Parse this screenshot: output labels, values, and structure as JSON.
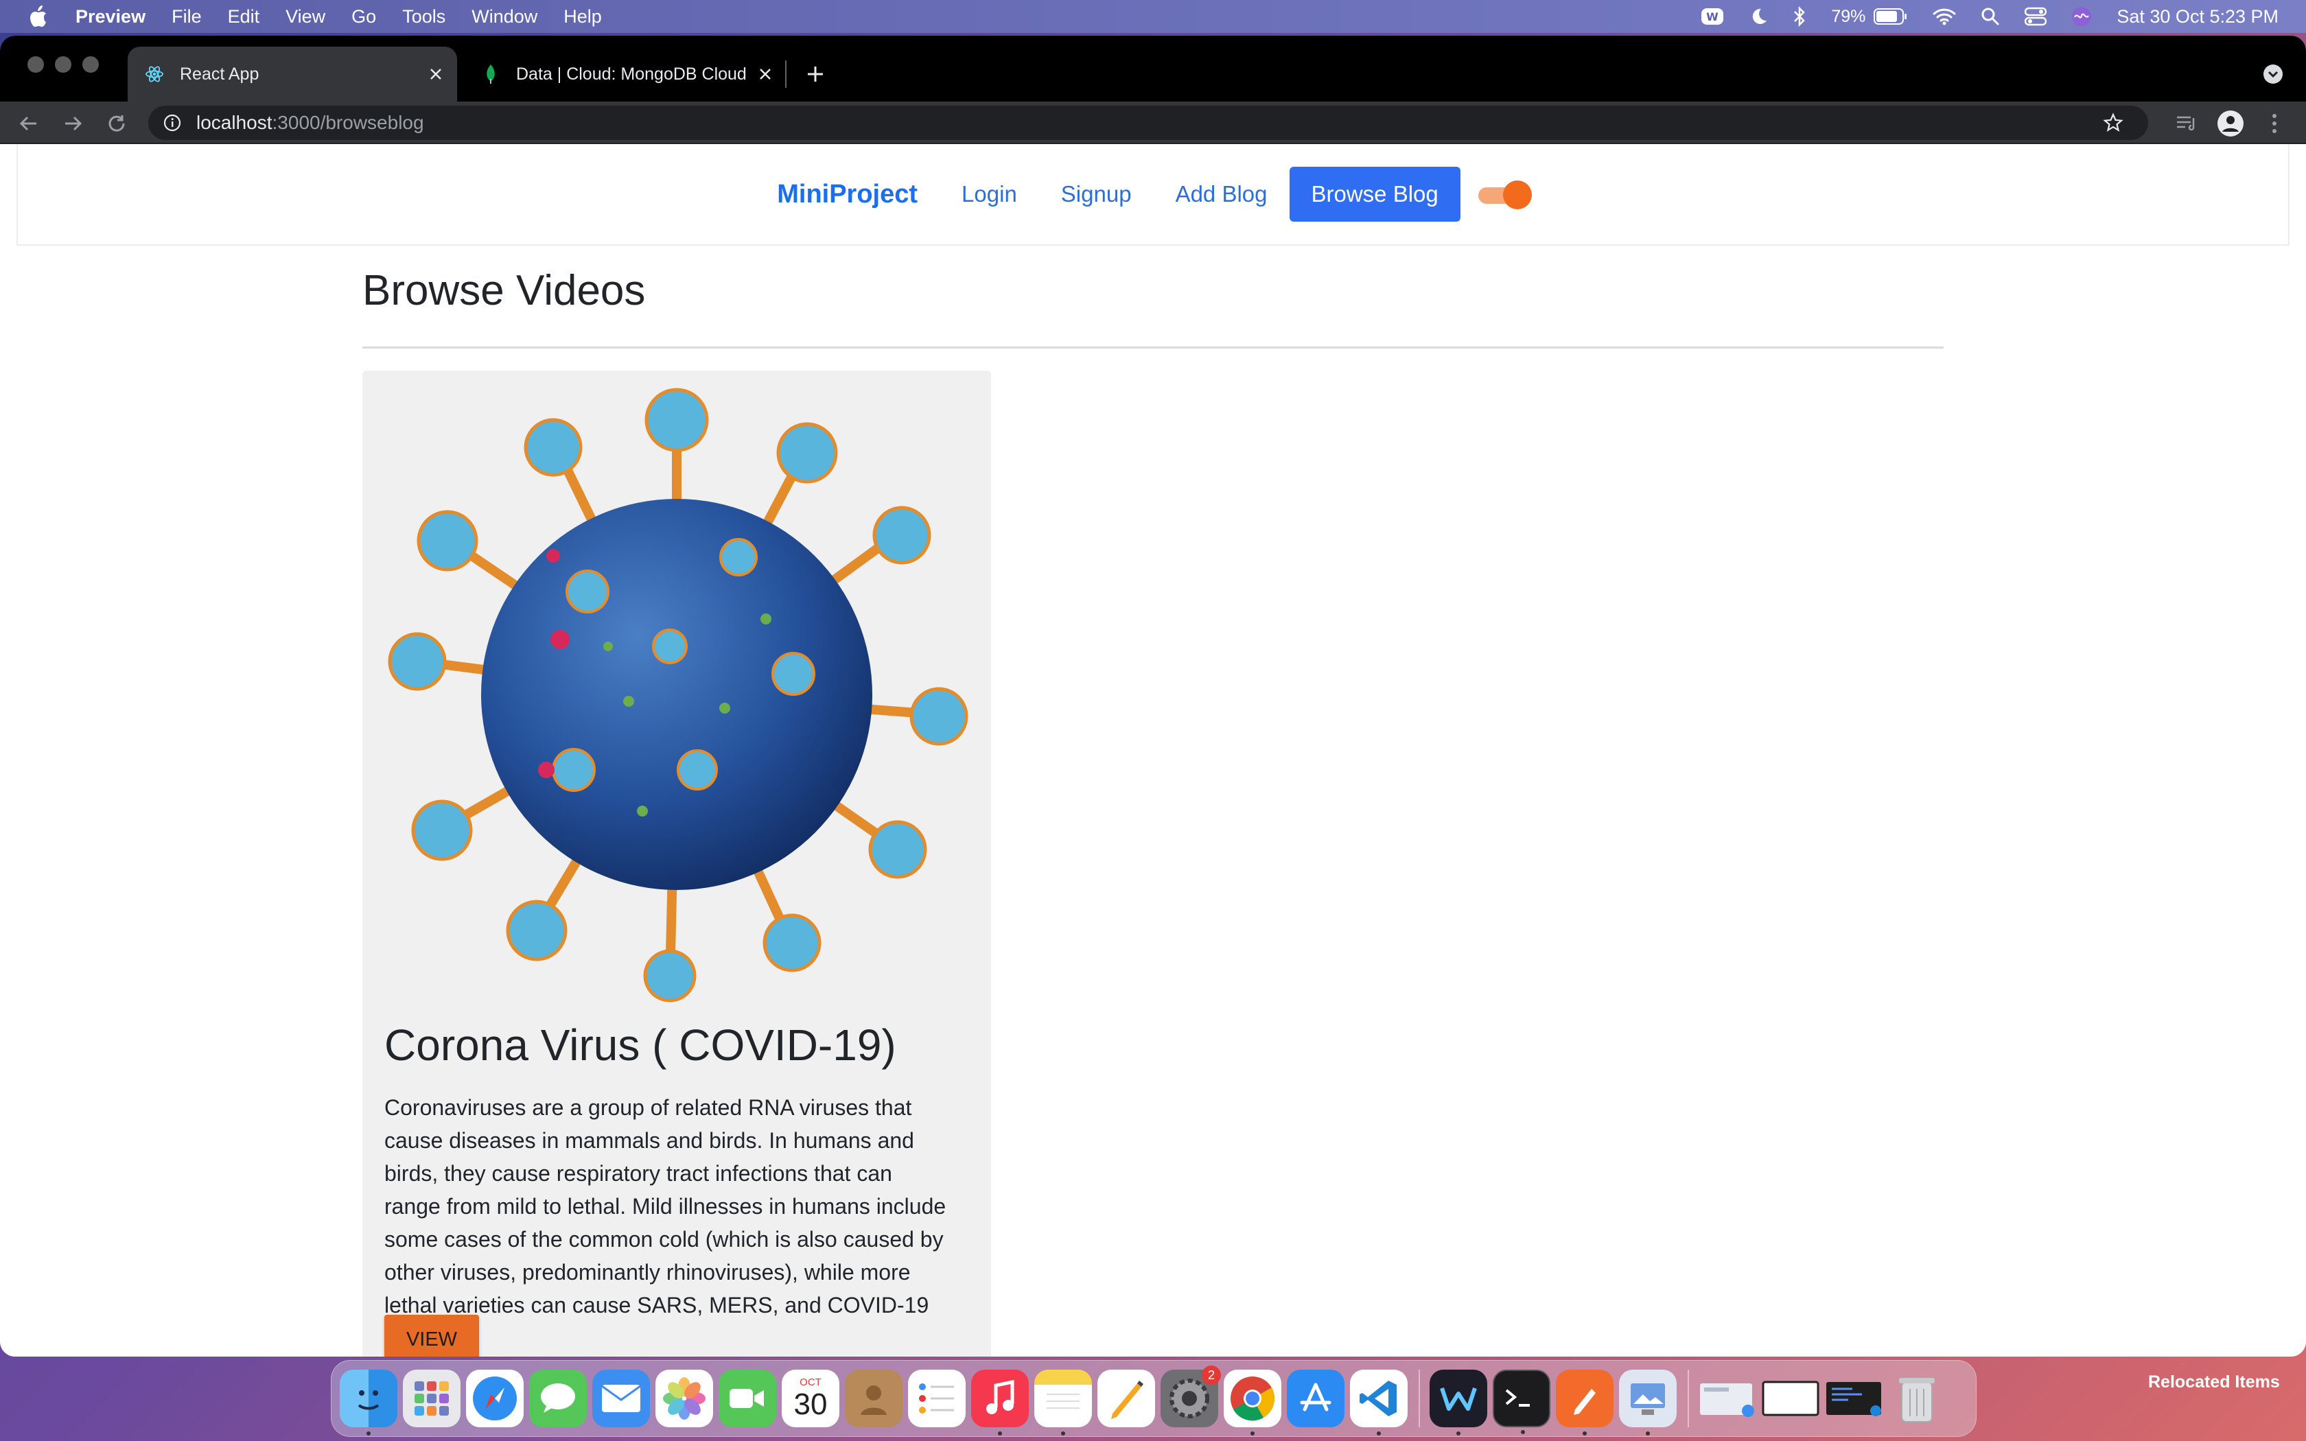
{
  "menubar": {
    "app_name": "Preview",
    "items": [
      "File",
      "Edit",
      "View",
      "Go",
      "Tools",
      "Window",
      "Help"
    ],
    "battery": "79%",
    "datetime": "Sat 30 Oct  5:23 PM"
  },
  "browser": {
    "tabs": [
      {
        "title": "React App",
        "favicon": "react-icon",
        "active": true
      },
      {
        "title": "Data | Cloud: MongoDB Cloud",
        "favicon": "mongodb-leaf-icon",
        "active": false
      }
    ],
    "url_host": "localhost",
    "url_path": ":3000/browseblog"
  },
  "navbar": {
    "brand": "MiniProject",
    "links": [
      "Login",
      "Signup",
      "Add Blog"
    ],
    "active_link": "Browse Blog"
  },
  "main": {
    "title": "Browse Videos",
    "card": {
      "title": "Corona Virus ( COVID-19)",
      "lines": [
        "Coronaviruses are a group of related RNA viruses that",
        "cause diseases in mammals and birds. In humans and",
        "birds, they cause respiratory tract infections that can",
        "range from mild to lethal. Mild illnesses in humans include",
        "some cases of the common cold (which is also caused by",
        "other viruses, predominantly rhinoviruses), while more",
        "lethal varieties can cause SARS, MERS, and COVID-19"
      ],
      "button": "VIEW"
    }
  },
  "dock": {
    "calendar_month": "OCT",
    "calendar_day": "30",
    "settings_badge": "2",
    "relocated_label": "Relocated Items"
  },
  "colors": {
    "accent": "#2f6ef2",
    "link": "#2d6fd8",
    "button": "#e76b24",
    "toggle": "#f26b1d"
  }
}
